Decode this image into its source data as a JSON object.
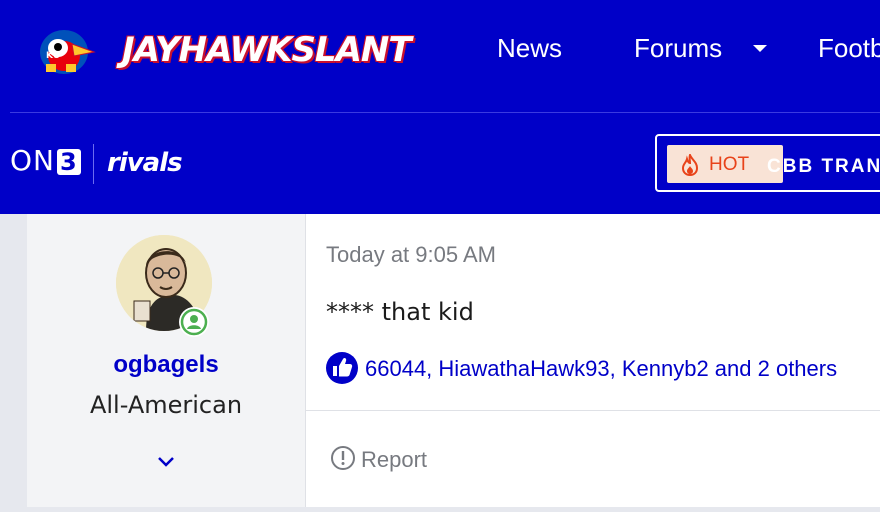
{
  "header": {
    "logo_text": "JAYHAWKSLANT",
    "nav": [
      {
        "label": "News"
      },
      {
        "label": "Forums"
      },
      {
        "label": "Footb"
      }
    ]
  },
  "subheader": {
    "brand_on": "ON",
    "brand_three": "3",
    "brand_rivals": "rivals",
    "hot_badge": "HOT",
    "hot_title": "CBB TRAN"
  },
  "post": {
    "username": "ogbagels",
    "user_title": "All-American",
    "timestamp": "Today at 9:05 AM",
    "message": "**** that kid",
    "likes_text": "66044, HiawathaHawk93, Kennyb2 and 2 others",
    "report_label": "Report"
  },
  "colors": {
    "brand_blue": "#0000c8",
    "hot_orange": "#e8431a",
    "online_green": "#4caf50"
  },
  "icons": [
    "jayhawk-mascot-icon",
    "chevron-down-icon",
    "flame-icon",
    "online-status-icon",
    "thumbs-up-icon",
    "alert-circle-icon"
  ]
}
